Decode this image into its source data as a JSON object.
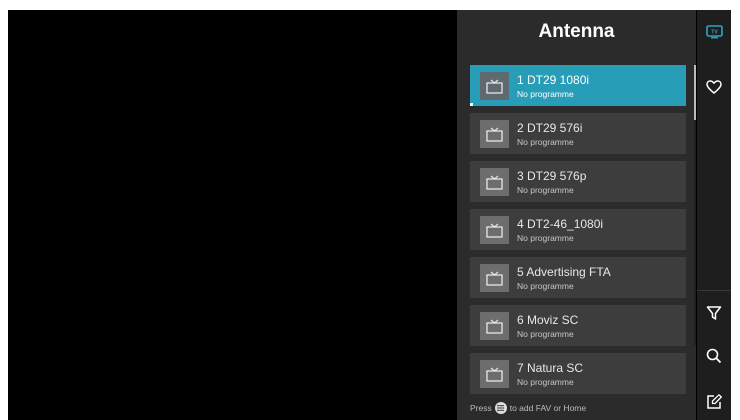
{
  "panel": {
    "title": "Antenna"
  },
  "channels": [
    {
      "name": "1 DT29 1080i",
      "program": "No programme",
      "selected": true
    },
    {
      "name": "2 DT29 576i",
      "program": "No programme",
      "selected": false
    },
    {
      "name": "3 DT29 576p",
      "program": "No programme",
      "selected": false
    },
    {
      "name": "4 DT2-46_1080i",
      "program": "No programme",
      "selected": false
    },
    {
      "name": "5 Advertising FTA",
      "program": "No programme",
      "selected": false
    },
    {
      "name": "6 Moviz SC",
      "program": "No programme",
      "selected": false
    },
    {
      "name": "7 Natura SC",
      "program": "No programme",
      "selected": false
    }
  ],
  "footer": {
    "press": "Press",
    "hint": "to add FAV or Home"
  },
  "rail": {
    "icons": [
      "tv-icon",
      "heart-icon",
      "filter-icon",
      "search-icon",
      "edit-icon"
    ],
    "accent": "#2aa6c8"
  },
  "colors": {
    "selected": "#289db8",
    "item": "#3d3d3d",
    "panel": "#2b2b2b"
  }
}
